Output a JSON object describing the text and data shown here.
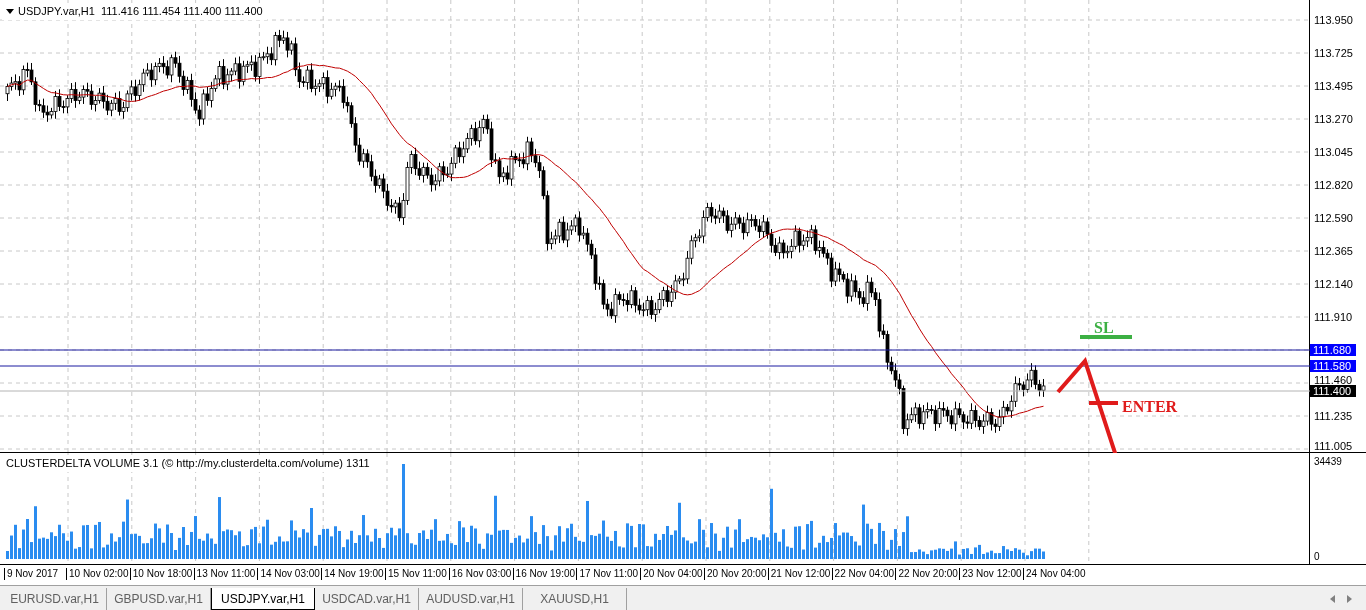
{
  "chart": {
    "title": "USDJPY.var,H1  111.416 111.454 111.400 111.400",
    "price_ticks": [
      "113.950",
      "113.725",
      "113.495",
      "113.270",
      "113.045",
      "112.820",
      "112.590",
      "112.365",
      "112.140",
      "111.910",
      "111.460",
      "111.235",
      "111.005"
    ],
    "levels": [
      {
        "label": "111.680",
        "kind": "line"
      },
      {
        "label": "111.580",
        "kind": "line"
      },
      {
        "label": "111.400",
        "kind": "bid"
      }
    ],
    "annotations": [
      {
        "text": "SL",
        "color": "#3cb043"
      },
      {
        "text": "ENTER",
        "color": "#e01b1b"
      }
    ]
  },
  "indicator": {
    "title": "CLUSTERDELTA VOLUME 3.1 (© http://my.clusterdelta.com/volume) 1311",
    "scale_max": "34439",
    "scale_min": "0"
  },
  "time_axis": [
    "9 Nov 2017",
    "10 Nov 02:00",
    "10 Nov 18:00",
    "13 Nov 11:00",
    "14 Nov 03:00",
    "14 Nov 19:00",
    "15 Nov 11:00",
    "16 Nov 03:00",
    "16 Nov 19:00",
    "17 Nov 11:00",
    "20 Nov 04:00",
    "20 Nov 20:00",
    "21 Nov 12:00",
    "22 Nov 04:00",
    "22 Nov 20:00",
    "23 Nov 12:00",
    "24 Nov 04:00"
  ],
  "tabs": [
    {
      "label": "EURUSD.var,H1",
      "selected": false
    },
    {
      "label": "GBPUSD.var,H1",
      "selected": false
    },
    {
      "label": "USDJPY.var,H1",
      "selected": true
    },
    {
      "label": "USDCAD.var,H1",
      "selected": false
    },
    {
      "label": "AUDUSD.var,H1",
      "selected": false
    },
    {
      "label": "XAUUSD,H1",
      "selected": false
    }
  ]
}
